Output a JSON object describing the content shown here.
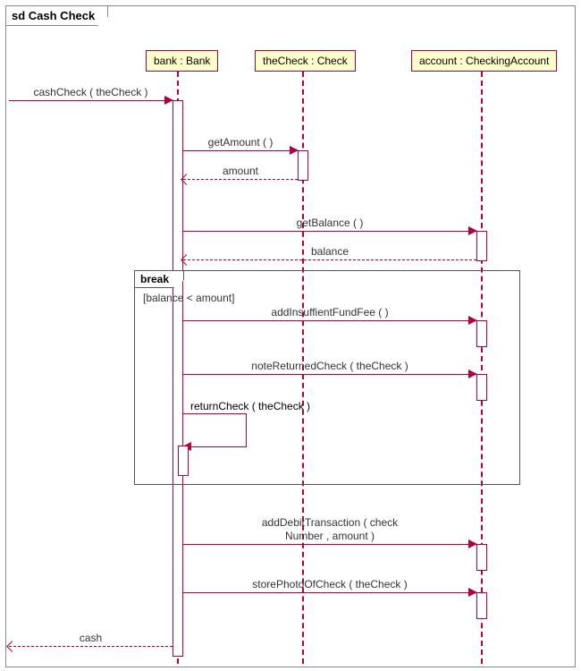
{
  "chart_data": {
    "type": "sequence-diagram",
    "title": "sd Cash Check",
    "lifelines": [
      {
        "id": "bank",
        "label": "bank : Bank"
      },
      {
        "id": "check",
        "label": "theCheck : Check"
      },
      {
        "id": "account",
        "label": "account : CheckingAccount"
      }
    ],
    "messages": [
      {
        "from": "external",
        "to": "bank",
        "label": "cashCheck ( theCheck )",
        "kind": "call"
      },
      {
        "from": "bank",
        "to": "check",
        "label": "getAmount (  )",
        "kind": "call"
      },
      {
        "from": "check",
        "to": "bank",
        "label": "amount",
        "kind": "return"
      },
      {
        "from": "bank",
        "to": "account",
        "label": "getBalance (  )",
        "kind": "call"
      },
      {
        "from": "account",
        "to": "bank",
        "label": "balance",
        "kind": "return"
      },
      {
        "fragment": "break",
        "guard": "[balance < amount]",
        "messages": [
          {
            "from": "bank",
            "to": "account",
            "label": "addInsuffientFundFee (  )",
            "kind": "call"
          },
          {
            "from": "bank",
            "to": "account",
            "label": "noteReturnedCheck ( theCheck )",
            "kind": "call"
          },
          {
            "from": "bank",
            "to": "bank",
            "label": "returnCheck ( theCheck )",
            "kind": "self"
          }
        ]
      },
      {
        "from": "bank",
        "to": "account",
        "label": "addDebitTransaction ( check Number , amount )",
        "kind": "call"
      },
      {
        "from": "bank",
        "to": "account",
        "label": "storePhotoOfCheck ( theCheck )",
        "kind": "call"
      },
      {
        "from": "bank",
        "to": "external",
        "label": "cash",
        "kind": "return"
      }
    ]
  },
  "frame": {
    "title": "sd Cash Check"
  },
  "lifelines": {
    "bank": {
      "label": "bank : Bank"
    },
    "check": {
      "label": "theCheck : Check"
    },
    "account": {
      "label": "account : CheckingAccount"
    }
  },
  "msgs": {
    "cashCheck": "cashCheck ( theCheck )",
    "getAmount": "getAmount (  )",
    "amount": "amount",
    "getBalance": "getBalance (  )",
    "balance": "balance",
    "addFee": "addInsuffientFundFee (  )",
    "noteRet": "noteReturnedCheck ( theCheck )",
    "returnCheck": "returnCheck ( theCheck )",
    "addDebit1": "addDebitTransaction ( check",
    "addDebit2": "Number , amount )",
    "storePhoto": "storePhotoOfCheck ( theCheck )",
    "cash": "cash"
  },
  "fragment": {
    "operator": "break",
    "guard": "[balance < amount]"
  }
}
